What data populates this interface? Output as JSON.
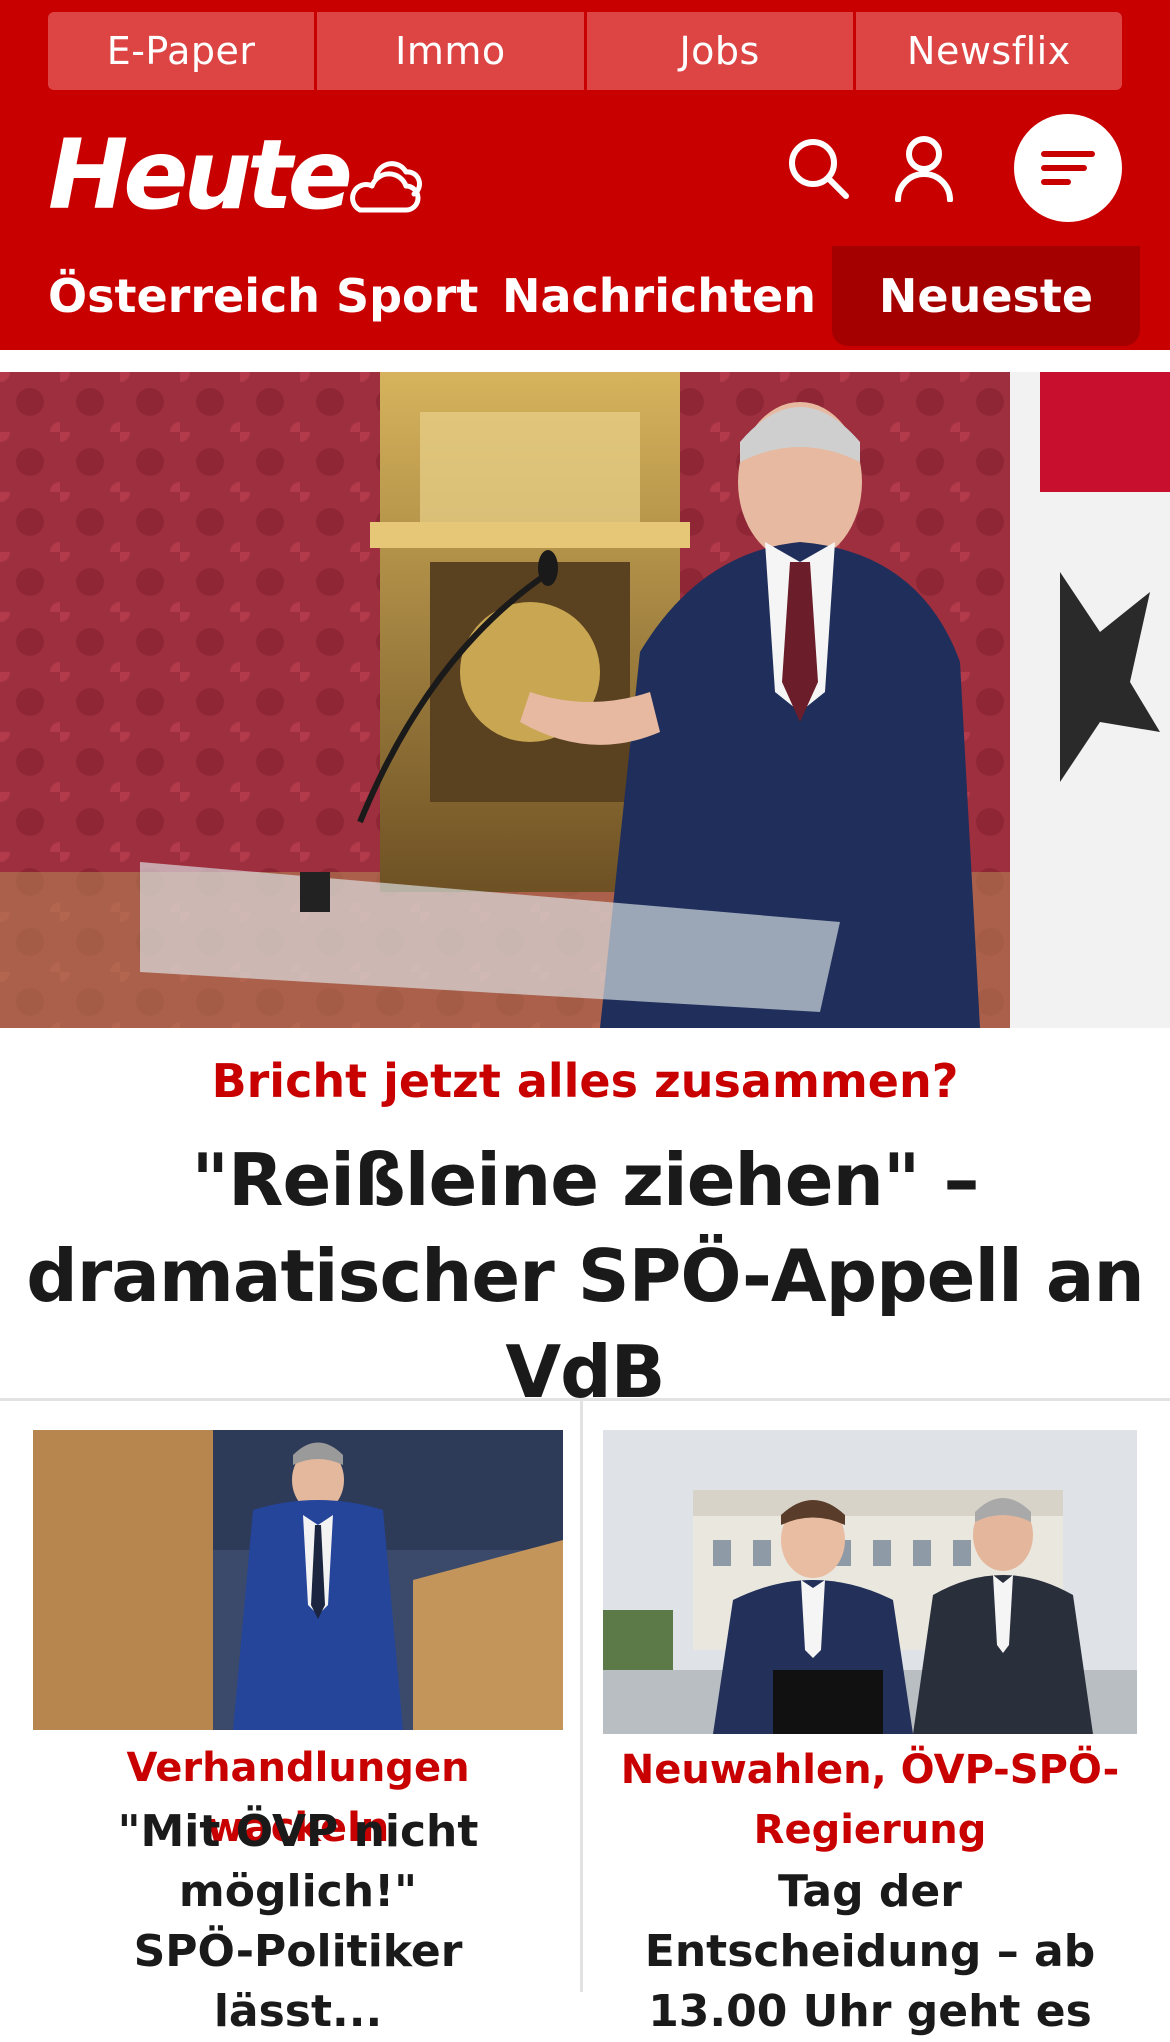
{
  "quicklinks": [
    "E-Paper",
    "Immo",
    "Jobs",
    "Newsflix"
  ],
  "header": {
    "logo": "Heute",
    "weather_icon": "cloud-sun-icon",
    "search_icon": "search-icon",
    "user_icon": "user-icon",
    "menu_icon": "menu-icon"
  },
  "nav": {
    "items": [
      "Österreich",
      "Sport",
      "Nachrichten"
    ],
    "highlight": "Neueste"
  },
  "hero": {
    "kicker": "Bricht jetzt alles zusammen?",
    "title": "\"Reißleine ziehen\" – dramatischer SPÖ-Appell an VdB"
  },
  "cards": [
    {
      "kicker": "Verhandlungen wackeln",
      "title": "\"Mit ÖVP nicht möglich!\" SPÖ-Politiker lässt..."
    },
    {
      "kicker": "Neuwahlen, ÖVP-SPÖ-Regierung",
      "title": "Tag der Entscheidung – ab 13.00 Uhr geht es"
    }
  ],
  "colors": {
    "brand_red": "#c80000",
    "quicklink_bg": "#dd4545",
    "active_tab": "#a50000"
  }
}
